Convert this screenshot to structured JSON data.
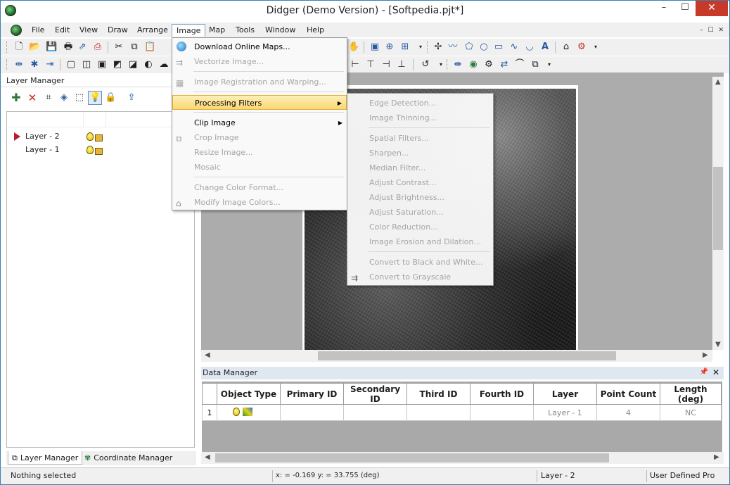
{
  "window": {
    "title": "Didger (Demo Version) - [Softpedia.pjt*]",
    "minimize": "–",
    "maximize": "☐",
    "close": "✕"
  },
  "menubar": {
    "items": [
      "File",
      "Edit",
      "View",
      "Draw",
      "Arrange",
      "Image",
      "Map",
      "Tools",
      "Window",
      "Help"
    ],
    "active": "Image",
    "mdi_controls": "–  ☐  ✕"
  },
  "layer_manager": {
    "title": "Layer Manager",
    "layers": [
      {
        "name": "Layer - 2",
        "selected": true
      },
      {
        "name": "Layer - 1",
        "selected": false
      }
    ],
    "tabs": [
      "Layer Manager",
      "Coordinate Manager"
    ]
  },
  "image_menu": {
    "items": [
      {
        "label": "Download Online Maps...",
        "enabled": true,
        "icon": "globe-icon"
      },
      {
        "label": "Vectorize Image...",
        "enabled": false,
        "icon": "vectorize-icon"
      },
      {
        "label": "Image Registration and Warping...",
        "enabled": false,
        "icon": "registration-icon"
      },
      {
        "label": "Processing Filters",
        "enabled": true,
        "submenu": true,
        "highlighted": true
      },
      {
        "label": "Clip Image",
        "enabled": true,
        "submenu": true
      },
      {
        "label": "Crop Image",
        "enabled": false,
        "icon": "crop-icon"
      },
      {
        "label": "Resize Image...",
        "enabled": false
      },
      {
        "label": "Mosaic",
        "enabled": false
      },
      {
        "label": "Change Color Format...",
        "enabled": false
      },
      {
        "label": "Modify Image Colors...",
        "enabled": false,
        "icon": "colors-icon"
      }
    ]
  },
  "filters_menu": {
    "items": [
      "Edge Detection...",
      "Image Thinning...",
      "Spatial Filters...",
      "Sharpen...",
      "Median Filter...",
      "Adjust Contrast...",
      "Adjust Brightness...",
      "Adjust Saturation...",
      "Color Reduction...",
      "Image Erosion and Dilation...",
      "Convert to Black and White...",
      "Convert to Grayscale"
    ]
  },
  "data_manager": {
    "title": "Data Manager",
    "columns": [
      "",
      "Object Type",
      "Primary ID",
      "Secondary ID",
      "Third ID",
      "Fourth ID",
      "Layer",
      "Point Count",
      "Length (deg)"
    ],
    "rows": [
      {
        "num": "1",
        "object_type": "",
        "primary": "",
        "secondary": "",
        "third": "",
        "fourth": "",
        "layer": "Layer - 1",
        "point_count": "4",
        "length": "NC"
      }
    ]
  },
  "statusbar": {
    "selection": "Nothing selected",
    "coords": "x: = -0.169 y: = 33.755 (deg)",
    "layer": "Layer - 2",
    "projection": "User Defined Pro"
  }
}
